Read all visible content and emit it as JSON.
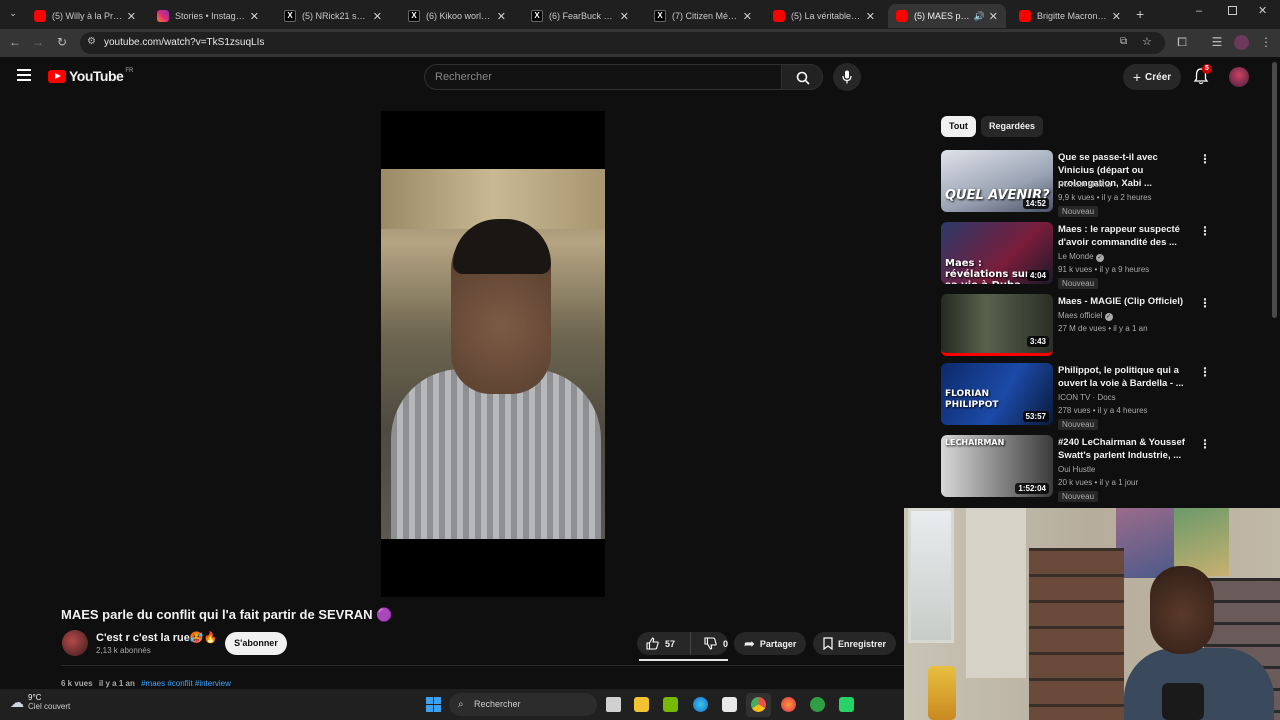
{
  "browser": {
    "tabs": [
      {
        "title": "(5) Willy à la Prod - Yo",
        "icon": "youtube-icon"
      },
      {
        "title": "Stories • Instagram",
        "icon": "instagram-icon"
      },
      {
        "title": "(5) NRick21 sur X : \"M",
        "icon": "x-icon"
      },
      {
        "title": "(6) Kikoo world (@Ki",
        "icon": "x-icon"
      },
      {
        "title": "(6) FearBuck sur X : \"",
        "icon": "x-icon"
      },
      {
        "title": "(7) Citizen Média ✏",
        "icon": "x-icon"
      },
      {
        "title": "(5) La véritable histo",
        "icon": "youtube-icon"
      },
      {
        "title": "(5) MAES parle d",
        "icon": "youtube-icon"
      },
      {
        "title": "Brigitte Macron : pro",
        "icon": "youtube-icon"
      }
    ],
    "url": "youtube.com/watch?v=TkS1zsuqLIs"
  },
  "youtube": {
    "logo_text": "YouTube",
    "region": "FR",
    "search_placeholder": "Rechercher",
    "create_label": "Créer",
    "notif_count": "5"
  },
  "video": {
    "title": "MAES parle du conflit qui l'a fait partir de SEVRAN 🟣",
    "channel": "C'est r c'est la rue🥵🔥",
    "subscribers": "2,13 k abonnés",
    "subscribe_label": "S'abonner",
    "likes": "57",
    "dislikes": "0",
    "share_label": "Partager",
    "save_label": "Enregistrer",
    "views": "6 k vues",
    "age": "il y a 1 an",
    "tags": "#maes #conflit #interview"
  },
  "sidebar": {
    "chips": [
      "Tout",
      "Regardées"
    ],
    "recommendations": [
      {
        "title": "Que se passe-t-il avec Vinicius (départ ou prolongation, Xabi ...",
        "channel": "Romain Molina",
        "verified": false,
        "meta": "9,9 k vues • il y a 2 heures",
        "badge": "Nouveau",
        "duration": "14:52",
        "thumb_text": "QUEL AVENIR?"
      },
      {
        "title": "Maes : le rappeur suspecté d'avoir commandité des ...",
        "channel": "Le Monde",
        "verified": true,
        "meta": "91 k vues • il y a 9 heures",
        "badge": "Nouveau",
        "duration": "4:04",
        "thumb_text": "Maes : révélations sur sa vie à Duba"
      },
      {
        "title": "Maes - MAGIE (Clip Officiel)",
        "channel": "Maes officiel",
        "verified": true,
        "meta": "27 M de vues • il y a 1 an",
        "badge": "",
        "duration": "3:43",
        "thumb_text": ""
      },
      {
        "title": "Philippot, le politique qui a ouvert la voie à Bardella - ...",
        "channel": "ICON TV · Docs",
        "verified": false,
        "meta": "278 vues • il y a 4 heures",
        "badge": "Nouveau",
        "duration": "53:57",
        "thumb_text": "FLORIAN PHILIPPOT"
      },
      {
        "title": "#240 LeChairman & Youssef Swatt's parlent Industrie, ...",
        "channel": "Oui Hustle",
        "verified": false,
        "meta": "20 k vues • il y a 1 jour",
        "badge": "Nouveau",
        "duration": "1:52:04",
        "thumb_text": "LECHAIRMAN"
      }
    ]
  },
  "taskbar": {
    "weather_temp": "9°C",
    "weather_desc": "Ciel couvert",
    "search_label": "Rechercher"
  },
  "colors": {
    "background": "#0f0f0f",
    "accent_red": "#ff0000",
    "link_blue": "#3ea6ff"
  }
}
